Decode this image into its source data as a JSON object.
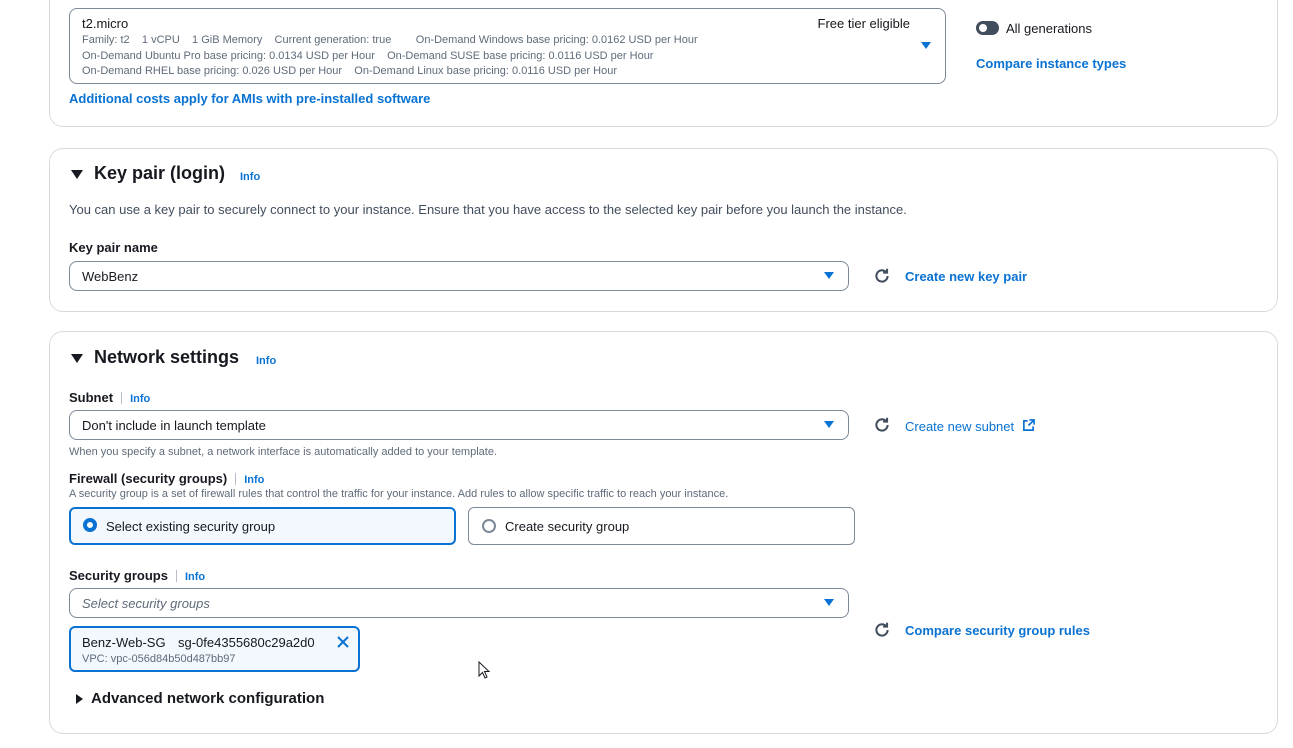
{
  "instance_type": {
    "name": "t2.micro",
    "free_tier": "Free tier eligible",
    "line1": "Family: t2    1 vCPU    1 GiB Memory    Current generation: true        On-Demand Windows base pricing: 0.0162 USD per Hour",
    "line2": "On-Demand Ubuntu Pro base pricing: 0.0134 USD per Hour    On-Demand SUSE base pricing: 0.0116 USD per Hour",
    "line3": "On-Demand RHEL base pricing: 0.026 USD per Hour    On-Demand Linux base pricing: 0.0116 USD per Hour",
    "all_generations_label": "All generations",
    "compare_link": "Compare instance types",
    "additional_costs_link": "Additional costs apply for AMIs with pre-installed software"
  },
  "key_pair": {
    "title": "Key pair (login)",
    "info": "Info",
    "description": "You can use a key pair to securely connect to your instance. Ensure that you have access to the selected key pair before you launch the instance.",
    "name_label": "Key pair name",
    "selected": "WebBenz",
    "create_link": "Create new key pair"
  },
  "network": {
    "title": "Network settings",
    "info": "Info",
    "subnet_label": "Subnet",
    "subnet_info": "Info",
    "subnet_value": "Don't include in launch template",
    "subnet_hint": "When you specify a subnet, a network interface is automatically added to your template.",
    "create_subnet_link": "Create new subnet",
    "firewall_label": "Firewall (security groups)",
    "firewall_info": "Info",
    "firewall_desc": "A security group is a set of firewall rules that control the traffic for your instance. Add rules to allow specific traffic to reach your instance.",
    "option_existing": "Select existing security group",
    "option_create": "Create security group",
    "sg_label": "Security groups",
    "sg_info": "Info",
    "sg_placeholder": "Select security groups",
    "token_name": "Benz-Web-SG",
    "token_id": "sg-0fe4355680c29a2d0",
    "token_vpc": "VPC: vpc-056d84b50d487bb97",
    "compare_sg_link": "Compare security group rules",
    "advanced_label": "Advanced network configuration"
  },
  "colors": {
    "accent": "#0972d3",
    "selected_tile_bg": "#f2f8fd",
    "border": "#7d8998"
  },
  "icons": [
    "refresh-icon",
    "external-link-icon",
    "close-icon",
    "caret-down-icon",
    "caret-right-icon",
    "mouse-cursor-icon"
  ]
}
